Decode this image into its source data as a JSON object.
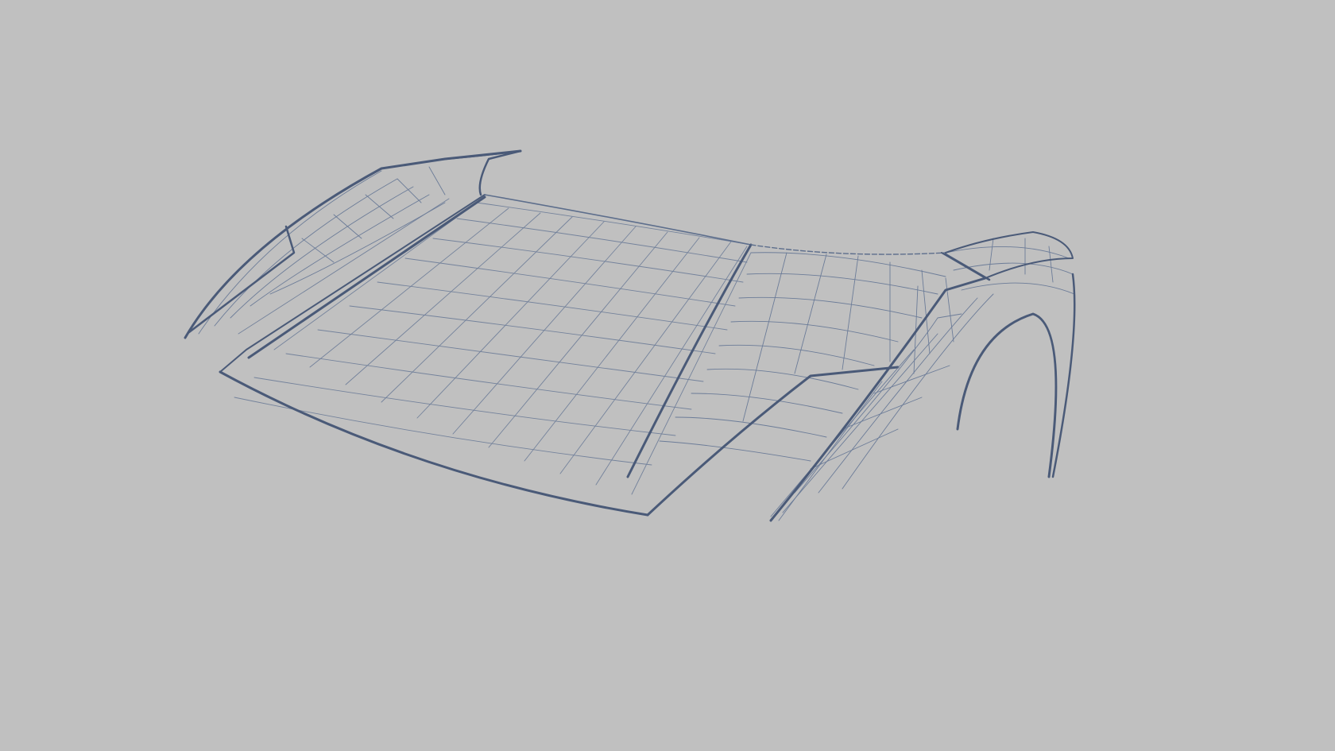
{
  "viewport": {
    "background": "#c0c0c0",
    "wire_color": "#5d6e8c",
    "edge_color": "#4a5a78",
    "object": "car-body-panels-wireframe"
  }
}
